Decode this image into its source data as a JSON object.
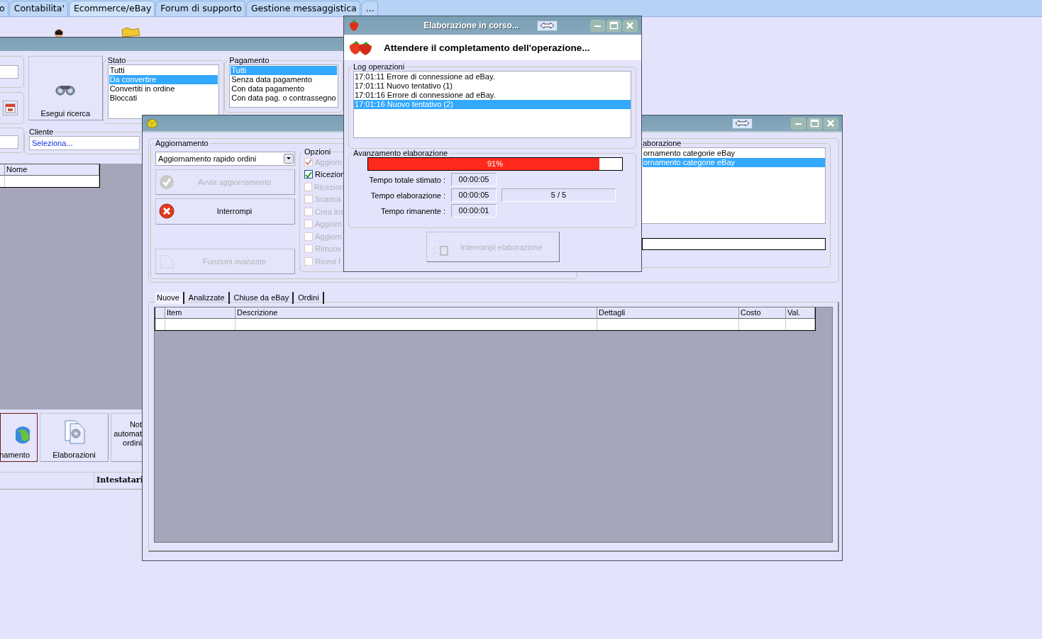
{
  "app_tabs": [
    {
      "label": "o",
      "selected": false
    },
    {
      "label": "Contabilita'",
      "selected": false
    },
    {
      "label": "Ecommerce/eBay",
      "selected": true
    },
    {
      "label": "Forum di supporto",
      "selected": false
    },
    {
      "label": "Gestione messaggistica",
      "selected": false
    },
    {
      "label": "...",
      "selected": false
    }
  ],
  "main_window": {
    "search_button": "Esegui ricerca",
    "stato": {
      "title": "Stato",
      "items": [
        {
          "label": "Tutti",
          "selected": false
        },
        {
          "label": "Da convertire",
          "selected": true
        },
        {
          "label": "Convertiti in ordine",
          "selected": false
        },
        {
          "label": "Bloccati",
          "selected": false
        }
      ]
    },
    "pagamento": {
      "title": "Pagamento",
      "items": [
        {
          "label": "Tutti",
          "selected": true
        },
        {
          "label": "Senza data pagamento",
          "selected": false
        },
        {
          "label": "Con data pagamento",
          "selected": false
        },
        {
          "label": "Con data pag. o contrassegno",
          "selected": false
        }
      ]
    },
    "cliente": {
      "title": "Cliente",
      "value": "Seleziona..."
    },
    "table": {
      "columns": [
        "Nome"
      ]
    },
    "buttons": [
      {
        "label": "namento",
        "kind": "globe",
        "selected": true
      },
      {
        "label": "Elaborazioni",
        "kind": "gear",
        "selected": false
      },
      {
        "label": "Not automat ordini",
        "kind": "text",
        "selected": false
      }
    ],
    "footer_column": "Intestatari"
  },
  "update_window": {
    "group_title": "Aggiornamento",
    "mode": {
      "value": "Aggiornamento rapido ordini"
    },
    "buttons": [
      {
        "label": "Avvia aggiornamento",
        "kind": "check",
        "disabled": true
      },
      {
        "label": "Interrompi",
        "kind": "stop",
        "disabled": false
      },
      {
        "label": "Funzioni avanzate",
        "kind": "page",
        "disabled": true
      }
    ],
    "options": {
      "title": "Opzioni",
      "items": [
        {
          "label": "Aggiorn",
          "checked": true,
          "disabled": true
        },
        {
          "label": "Ricezion",
          "checked": true,
          "disabled": false
        },
        {
          "label": "Ricezion",
          "checked": false,
          "disabled": true
        },
        {
          "label": "Scarica",
          "checked": false,
          "disabled": true
        },
        {
          "label": "Crea ins",
          "checked": false,
          "disabled": true
        },
        {
          "label": "Aggiorn",
          "checked": false,
          "disabled": true
        },
        {
          "label": "Aggiorn",
          "checked": false,
          "disabled": true
        },
        {
          "label": "Rimuov",
          "checked": false,
          "disabled": true
        },
        {
          "label": "Ricevi f",
          "checked": false,
          "disabled": true
        }
      ]
    },
    "activity": {
      "title": "aborazione",
      "items": [
        {
          "label": "ornamento categorie eBay",
          "selected": false
        },
        {
          "label": "ornamento categorie eBay",
          "selected": true
        }
      ]
    },
    "tabs": [
      {
        "label": "Nuove",
        "selected": true
      },
      {
        "label": "Analizzate",
        "selected": false
      },
      {
        "label": "Chiuse da eBay",
        "selected": false
      },
      {
        "label": "Ordini",
        "selected": false
      }
    ],
    "table": {
      "columns": [
        "Item",
        "Descrizione",
        "Dettagli",
        "Costo",
        "Val."
      ]
    }
  },
  "dialog": {
    "title": "Elaborazione in corso...",
    "message": "Attendere il completamento dell'operazione...",
    "log_title": "Log operazioni",
    "log": [
      {
        "text": "17:01:11 Errore di connessione ad eBay.",
        "selected": false
      },
      {
        "text": "17:01:11 Nuovo tentativo (1)",
        "selected": false
      },
      {
        "text": "17:01:16 Errore di connessione ad eBay.",
        "selected": false
      },
      {
        "text": "17:01:16 Nuovo tentativo (2)",
        "selected": true
      }
    ],
    "progress_title": "Avanzamento elaborazione",
    "progress": {
      "level": 0.91,
      "reading": "91%"
    },
    "times": [
      {
        "label": "Tempo totale stimato :",
        "value": "00:00:05"
      },
      {
        "label": "Tempo elaborazione :",
        "value": "00:00:05"
      },
      {
        "label": "Tempo rimanente :",
        "value": "00:00:01"
      }
    ],
    "count": "5 / 5",
    "stop_button": {
      "label": "Interrompi elaborazione",
      "disabled": true
    }
  }
}
